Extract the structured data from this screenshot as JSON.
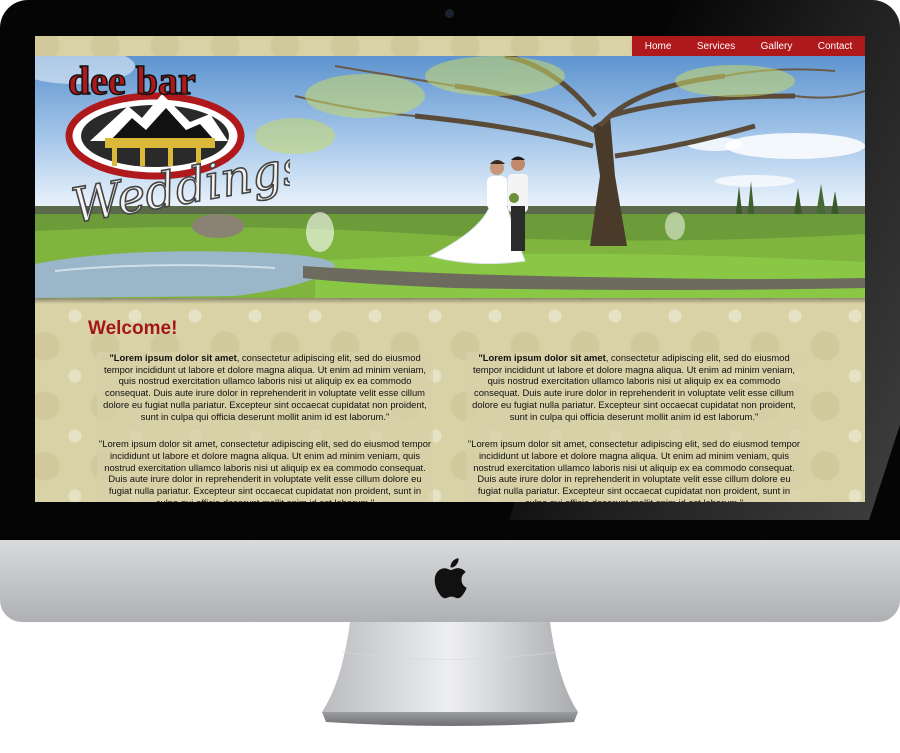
{
  "nav": {
    "items": [
      {
        "label": "Home"
      },
      {
        "label": "Services"
      },
      {
        "label": "Gallery"
      },
      {
        "label": "Contact"
      }
    ],
    "color": "#b0191b"
  },
  "logo": {
    "line1": "dee bar",
    "line2": "Weddings",
    "color": "#b0191b"
  },
  "hero": {
    "description_icon": "couple-under-tree-photo"
  },
  "welcome": {
    "heading": "Welcome!",
    "color": "#a3171a"
  },
  "columns": [
    {
      "paragraphs": [
        {
          "lead": "\"Lorem ipsum dolor sit amet",
          "text": ", consectetur adipiscing elit, sed do eiusmod tempor incididunt ut labore et dolore magna aliqua. Ut enim ad minim veniam, quis nostrud exercitation ullamco laboris nisi ut aliquip ex ea commodo consequat. Duis aute irure dolor in reprehenderit in voluptate velit esse cillum dolore eu fugiat nulla pariatur. Excepteur sint occaecat cupidatat non proident, sunt in culpa qui officia deserunt mollit anim id est laborum.\""
        },
        {
          "lead": "",
          "text": "\"Lorem ipsum dolor sit amet, consectetur adipiscing elit, sed do eiusmod tempor incididunt ut labore et dolore magna aliqua. Ut enim ad minim veniam, quis nostrud exercitation ullamco laboris nisi ut aliquip ex ea commodo consequat. Duis aute irure dolor in reprehenderit in voluptate velit esse cillum dolore eu fugiat nulla pariatur. Excepteur sint occaecat cupidatat non proident, sunt in culpa qui officia deserunt mollit anim id est laborum.\""
        }
      ]
    },
    {
      "paragraphs": [
        {
          "lead": "\"Lorem ipsum dolor sit amet",
          "text": ", consectetur adipiscing elit, sed do eiusmod tempor incididunt ut labore et dolore magna aliqua. Ut enim ad minim veniam, quis nostrud exercitation ullamco laboris nisi ut aliquip ex ea commodo consequat. Duis aute irure dolor in reprehenderit in voluptate velit esse cillum dolore eu fugiat nulla pariatur. Excepteur sint occaecat cupidatat non proident, sunt in culpa qui officia deserunt mollit anim id est laborum.\""
        },
        {
          "lead": "",
          "text": "\"Lorem ipsum dolor sit amet, consectetur adipiscing elit, sed do eiusmod tempor incididunt ut labore et dolore magna aliqua. Ut enim ad minim veniam, quis nostrud exercitation ullamco laboris nisi ut aliquip ex ea commodo consequat. Duis aute irure dolor in reprehenderit in voluptate velit esse cillum dolore eu fugiat nulla pariatur. Excepteur sint occaecat cupidatat non proident, sunt in culpa qui officia deserunt mollit anim id est laborum.\""
        }
      ]
    }
  ],
  "device": {
    "icon": "apple-logo-icon"
  }
}
